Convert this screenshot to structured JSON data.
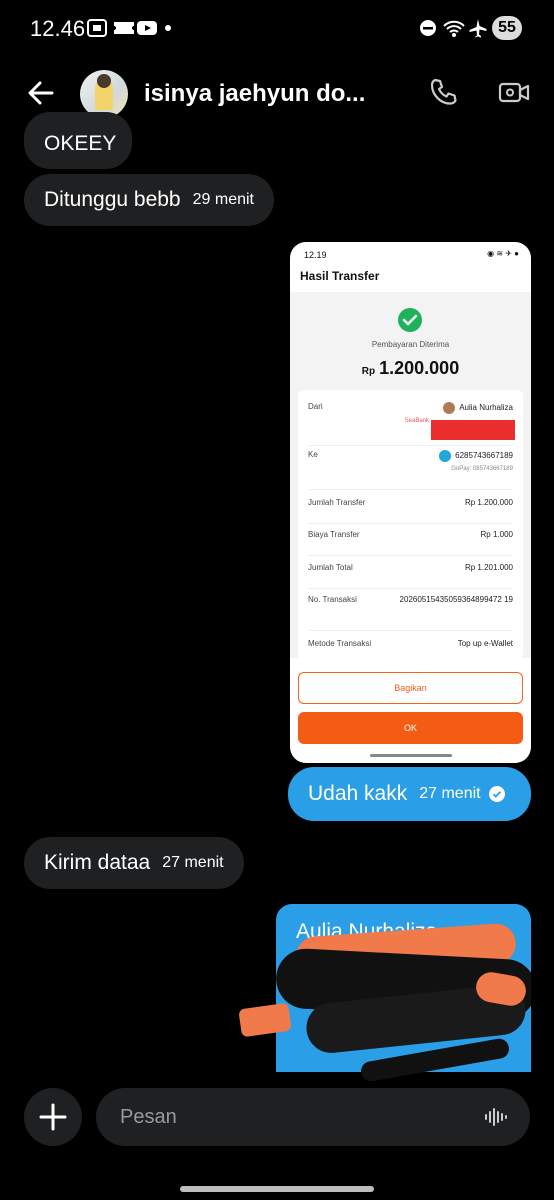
{
  "status_bar": {
    "time": "12.46",
    "battery": "55"
  },
  "header": {
    "title": "isinya jaehyun do..."
  },
  "messages": {
    "m1": {
      "text": "OKEEY"
    },
    "m2": {
      "text": "Ditunggu bebb",
      "time": "29 menit"
    },
    "m3": {
      "text": "Udah kakk",
      "time": "27 menit"
    },
    "m4": {
      "text": "Kirim dataa",
      "time": "27 menit"
    },
    "m5": {
      "text": "Aulia Nurhaliza"
    }
  },
  "screenshot": {
    "time": "12.19",
    "title": "Hasil Transfer",
    "status": "Pembayaran Diterima",
    "currency": "Rp",
    "amount": "1.200.000",
    "from_label": "Dari",
    "from_name": "Aulia Nurhaliza",
    "from_bank": "SeaBank",
    "to_label": "Ke",
    "to_number": "6285743667189",
    "to_sub": "GoPay: 085743667189",
    "rows": [
      {
        "label": "Jumlah Transfer",
        "value": "Rp 1.200.000"
      },
      {
        "label": "Biaya Transfer",
        "value": "Rp 1.000"
      },
      {
        "label": "Jumlah Total",
        "value": "Rp 1.201.000"
      },
      {
        "label": "No. Transaksi",
        "value": "20260515435059364899472 19"
      },
      {
        "label": "Metode Transaksi",
        "value": "Top up e-Wallet"
      }
    ],
    "share_button": "Bagikan",
    "ok_button": "OK"
  },
  "composer": {
    "placeholder": "Pesan"
  },
  "colors": {
    "outgoing": "#2a9ee6",
    "incoming": "#1f2022",
    "accent": "#f35c12"
  },
  "icons": [
    "back-arrow-icon",
    "phone-icon",
    "video-call-icon",
    "plus-icon",
    "voice-icon",
    "read-check-icon"
  ]
}
